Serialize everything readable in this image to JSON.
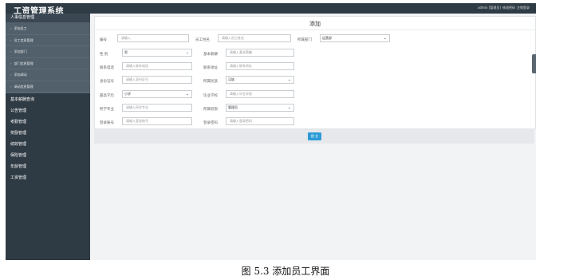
{
  "header": {
    "app_title": "工资管理系统",
    "user_label": "admin [管理员]",
    "change_password_link": "修改密码",
    "logout_link": "注销登录"
  },
  "sidebar": {
    "groups": [
      {
        "label": "人事信息管理",
        "items": [
          "添加员工",
          "员工信息管理",
          "添加部门",
          "部门信息管理",
          "添加调动",
          "调动信息管理"
        ]
      },
      {
        "label": "基本薪酬查询"
      },
      {
        "label": "公告管理"
      },
      {
        "label": "考勤管理"
      },
      {
        "label": "奖励管理"
      },
      {
        "label": "绩效管理"
      },
      {
        "label": "保险管理"
      },
      {
        "label": "年龄管理"
      },
      {
        "label": "工资管理"
      }
    ]
  },
  "form": {
    "title": "添加",
    "fields": {
      "emp_no": {
        "label": "编号",
        "placeholder": "请输入"
      },
      "emp_name": {
        "label": "员工姓名",
        "placeholder": "请输入员工姓名"
      },
      "department": {
        "label": "所属部门",
        "value": "运营部"
      },
      "gender": {
        "label": "性 别",
        "value": "男"
      },
      "base_salary": {
        "label": "基本薪酬",
        "placeholder": "请输入基本薪酬"
      },
      "phone": {
        "label": "联系电话",
        "placeholder": "请输入联系电话"
      },
      "address": {
        "label": "联系地址",
        "placeholder": "请输入联系地址"
      },
      "id_card": {
        "label": "身份证号",
        "placeholder": "请输入身份证号"
      },
      "ethnicity": {
        "label": "所属民族",
        "value": "汉族"
      },
      "education": {
        "label": "最高学历",
        "value": "小学"
      },
      "school": {
        "label": "毕业学校",
        "placeholder": "请输入毕业学校"
      },
      "major": {
        "label": "所学专业",
        "placeholder": "请输入所学专业"
      },
      "role": {
        "label": "所属权限",
        "value": "管理员"
      },
      "login_account": {
        "label": "登录账号",
        "placeholder": "请输入登录账号"
      },
      "login_password": {
        "label": "登录密码",
        "placeholder": "请输入登录密码"
      }
    },
    "submit_label": "提 交"
  },
  "caption": "图 5.3 添加员工界面"
}
